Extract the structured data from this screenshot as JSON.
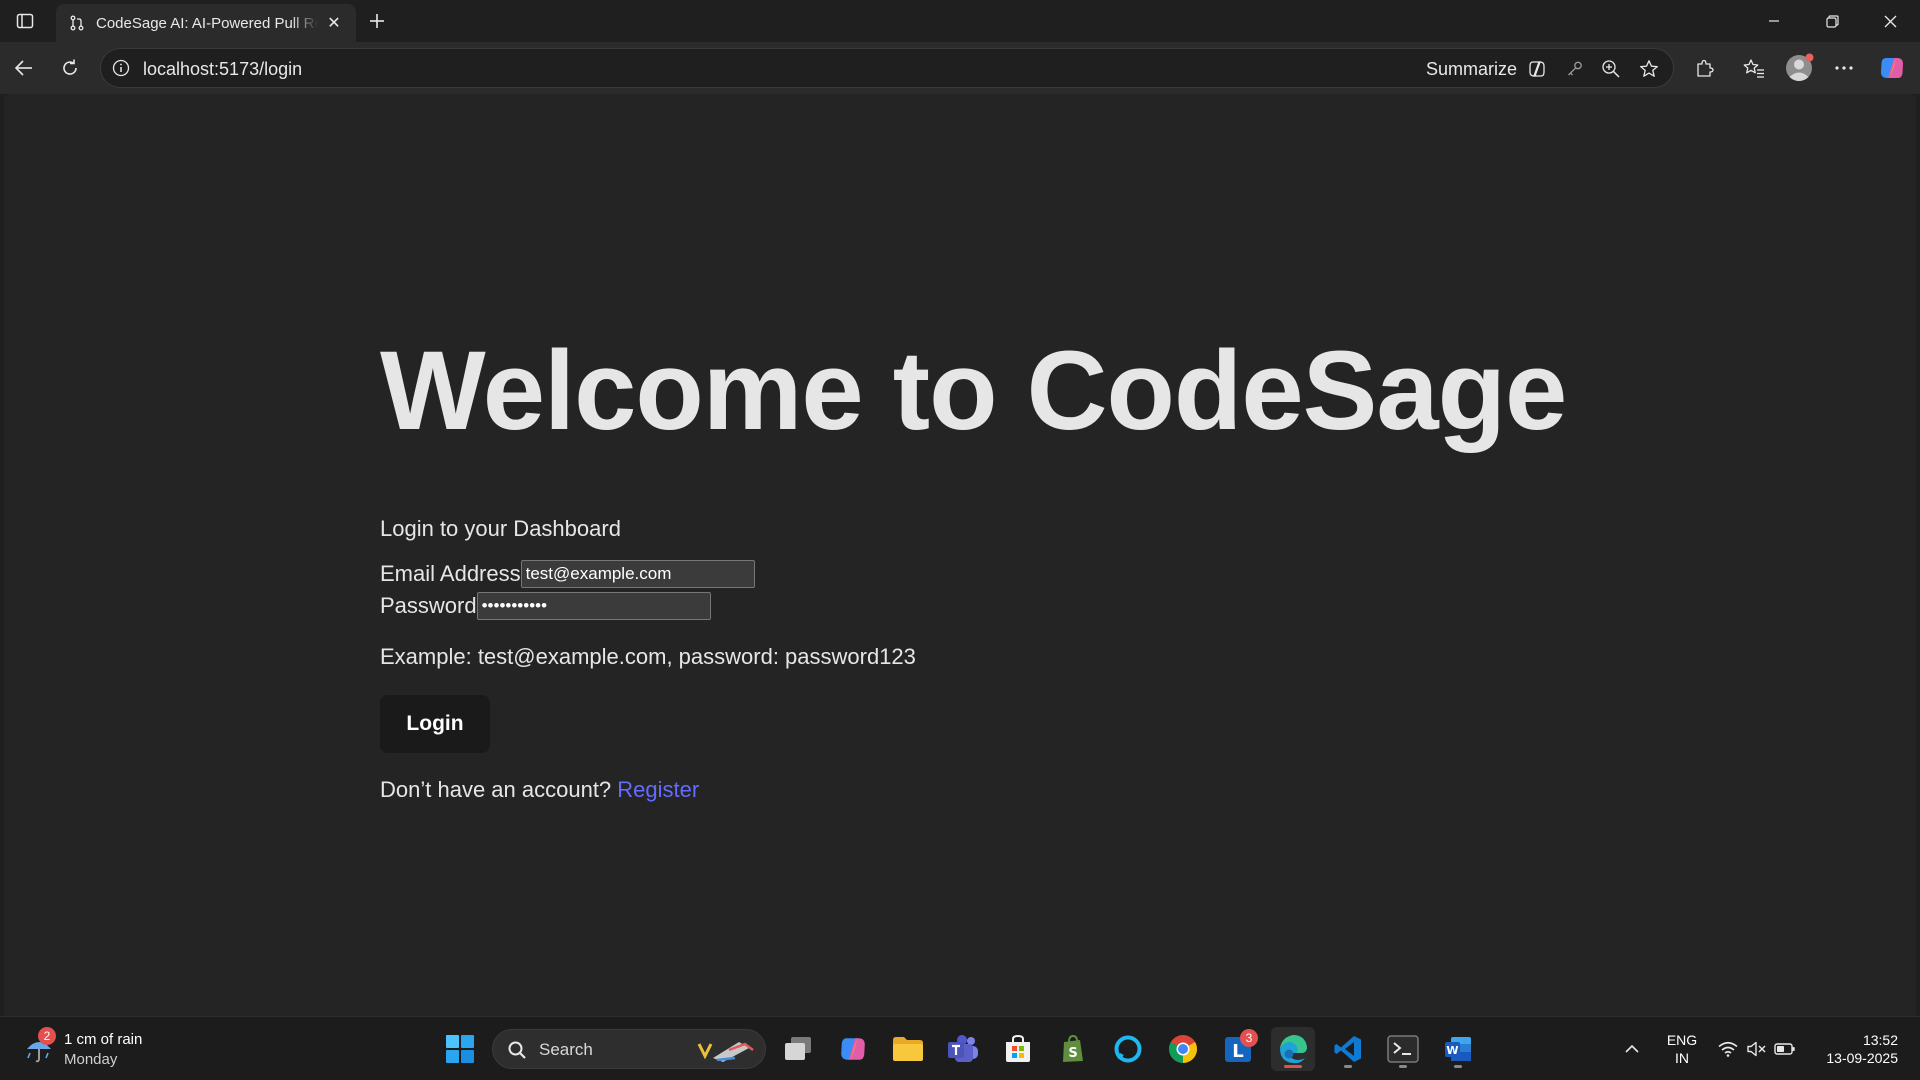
{
  "browser": {
    "tab_title": "CodeSage AI: AI-Powered Pull Request Review",
    "url": "localhost:5173/login",
    "summarize_label": "Summarize"
  },
  "page": {
    "title": "Welcome to CodeSage",
    "subtitle": "Login to your Dashboard",
    "email_label": "Email Address",
    "email_value": "test@example.com",
    "password_label": "Password",
    "password_value": "password123",
    "hint": "Example: test@example.com, password: password123",
    "login_button": "Login",
    "register_prompt": "Don’t have an account?",
    "register_link": "Register",
    "link_color": "#646cff"
  },
  "taskbar": {
    "weather_badge": "2",
    "weather_line1": "1 cm of rain",
    "weather_line2": "Monday",
    "search_label": "Search",
    "outlook_badge": "3",
    "lang_line1": "ENG",
    "lang_line2": "IN",
    "time": "13:52",
    "date": "13-09-2025",
    "apps": [
      "windows-start",
      "search",
      "task-view",
      "copilot",
      "file-explorer",
      "teams",
      "microsoft-store",
      "shopify",
      "alexa",
      "chrome",
      "outlook-lite",
      "edge",
      "vscode",
      "terminal",
      "word"
    ]
  }
}
